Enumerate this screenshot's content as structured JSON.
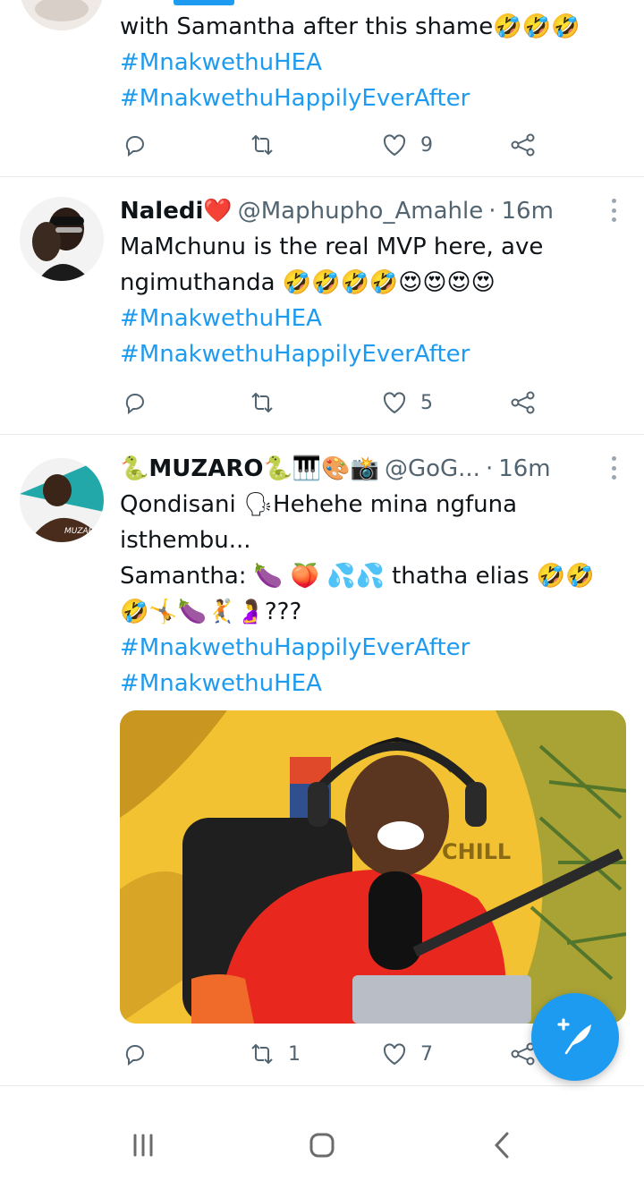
{
  "tweets": [
    {
      "lines": [
        "with Samantha after this shame🤣🤣🤣"
      ],
      "hashtags": [
        "#MnakwethuHEA",
        "#MnakwethuHappilyEverAfter"
      ],
      "likes": "9"
    },
    {
      "display_name": "Naledi❤️",
      "handle": "@Maphupho_Amahle",
      "separator": "·",
      "time": "16m",
      "lines": [
        "MaMchunu is the real MVP here, ave",
        "ngimuthanda 🤣🤣🤣🤣😍😍😍😍"
      ],
      "hashtags": [
        "#MnakwethuHEA",
        "#MnakwethuHappilyEverAfter"
      ],
      "likes": "5"
    },
    {
      "display_name": "🐍MUZARO🐍🎹🎨📸",
      "handle": "@GoG...",
      "separator": "·",
      "time": "16m",
      "lines": [
        "Qondisani 🗣Hehehe mina ngfuna",
        "isthembu...",
        "Samantha: 🍆 🍑 💦💦 thatha elias 🤣🤣",
        "🤣🤸🍆🤾🤰???"
      ],
      "hashtags": [
        "#MnakwethuHappilyEverAfter",
        "#MnakwethuHEA"
      ],
      "media": {
        "background_text": "CHILL",
        "accent": "#f2c232",
        "shirt": "#e8281e"
      },
      "retweets": "1",
      "likes": "7"
    }
  ],
  "icons": {
    "reply": "reply-icon",
    "retweet": "retweet-icon",
    "like": "heart-icon",
    "share": "share-icon",
    "more": "more-vertical-icon",
    "compose": "compose-tweet-icon"
  },
  "nav": [
    "recent-apps-icon",
    "home-icon",
    "back-icon"
  ],
  "colors": {
    "link": "#1d9bf0",
    "secondary": "#536471",
    "text": "#0f1419"
  }
}
